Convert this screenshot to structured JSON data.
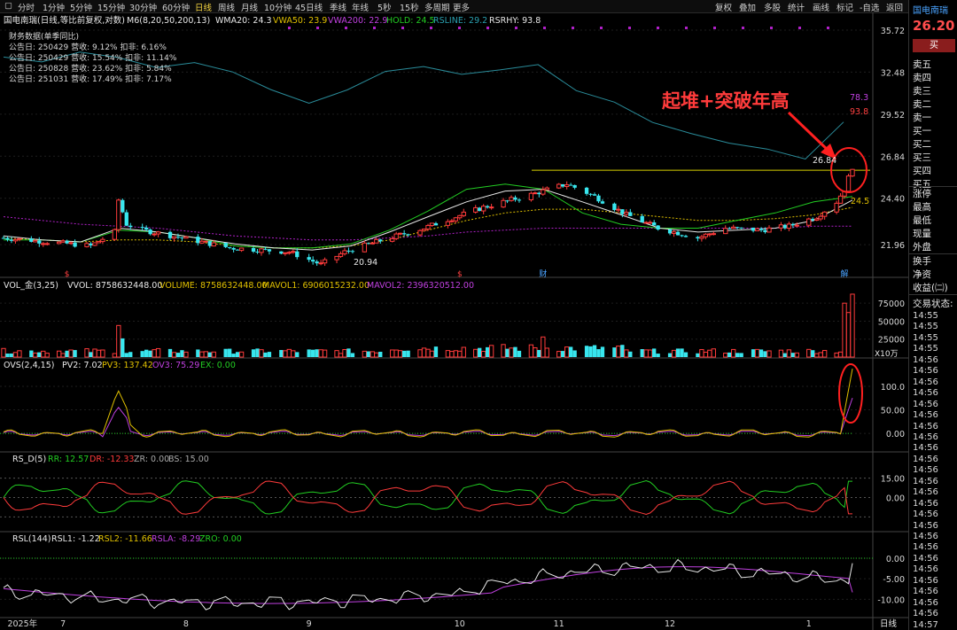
{
  "toolbar": {
    "left": [
      "分时",
      "1分钟",
      "5分钟",
      "15分钟",
      "30分钟",
      "60分钟",
      "日线",
      "周线",
      "月线",
      "10分钟",
      "45日线",
      "季线",
      "年线",
      "5秒",
      "15秒",
      "多周期",
      "更多"
    ],
    "active": "日线",
    "right": [
      "复权",
      "叠加",
      "多股",
      "统计",
      "画线",
      "标记",
      "-自选",
      "返回"
    ]
  },
  "main_pane": {
    "title": "国电南瑞(日线,等比前复权,对数)",
    "indicator": "M6(8,20,50,200,13)",
    "wma20": "WMA20: 24.3",
    "vwa50": "VWA50: 23.9",
    "vwa200": "VWA200: 22.9",
    "hold": "HOLD: 24.5",
    "rsline": "RSLINE: 29.2",
    "rsrhy": "RSRHY: 93.8",
    "fin_title": "财务数据(单季同比)",
    "fin_rows": [
      "公告日: 250429  营收: 9.12%  扣非: 6.16%",
      "公告日: 250429  营收: 15.54%  扣非: 11.14%",
      "公告日: 250828  营收: 23.62%  扣非: 5.84%",
      "公告日: 251031  营收: 17.49%  扣非: 7.17%"
    ],
    "annotation": "起堆+突破年高",
    "label_high": "26.84",
    "label_low": "20.94",
    "label_hold": "24.5",
    "label_rsline": "78.3",
    "label_rsrhy": "93.8",
    "markers": [
      {
        "text": "$",
        "x": "2025-07-02"
      },
      {
        "text": "$",
        "x": "2025-10-09"
      },
      {
        "text": "财",
        "x": "2025-10-30"
      },
      {
        "text": "解",
        "x": "2026-01-14"
      }
    ],
    "yticks": [
      "35.72",
      "32.48",
      "29.52",
      "26.84",
      "24.40",
      "21.96"
    ]
  },
  "vol_pane": {
    "title": "VOL_金(3,25)",
    "vvol": "VVOL: 8758632448.00",
    "volume": "VOLUME: 8758632448.00",
    "mavol1": "MAVOL1: 6906015232.00",
    "mavol2": "MAVOL2: 2396320512.00",
    "yticks": [
      "75000",
      "50000",
      "25000"
    ],
    "unit": "X10万"
  },
  "ovs_pane": {
    "title": "OVS(2,4,15)",
    "pv2": "PV2: 7.02",
    "pv3": "PV3: 137.42",
    "ov3": "OV3: 75.29",
    "ex": "EX: 0.00",
    "yticks": [
      "100.0",
      "50.00",
      "0.00"
    ]
  },
  "rsd_pane": {
    "title": "RS_D(5)",
    "rr": "RR: 12.57",
    "dr": "DR: -12.33",
    "zr": "ZR: 0.00",
    "bs": "BS: 15.00",
    "yticks": [
      "15.00",
      "0.00"
    ]
  },
  "rsl_pane": {
    "title": "RSL(144)",
    "rsl1": "RSL1: -1.22",
    "rsl2": "RSL2: -11.66",
    "rsla": "RSLA: -8.29",
    "zro": "ZRO: 0.00",
    "yticks": [
      "0.00",
      "-5.00",
      "-10.00"
    ]
  },
  "xaxis": {
    "labels": [
      "2025年",
      "7",
      "8",
      "9",
      "10",
      "11",
      "12",
      "1"
    ],
    "period": "日线"
  },
  "side": {
    "name": "国电南瑞",
    "price": "26.20",
    "price_suffix": "1.",
    "buy_button": "买",
    "order_book": [
      "卖五",
      "卖四",
      "卖三",
      "卖二",
      "卖一",
      "买一",
      "买二",
      "买三",
      "买四",
      "买五"
    ],
    "stats": [
      "涨停",
      "最高",
      "最低",
      "现量",
      "外盘"
    ],
    "stats2": [
      "换手",
      "净资",
      "收益(㈡)"
    ],
    "trade_status": "交易状态:",
    "times": [
      "14:55",
      "14:55",
      "14:55",
      "14:55",
      "14:56",
      "14:56",
      "14:56",
      "14:56",
      "14:56",
      "14:56",
      "14:56",
      "14:56",
      "14:56",
      "14:56",
      "14:56",
      "14:56",
      "14:56",
      "14:56",
      "14:56",
      "14:56",
      "14:56",
      "14:56",
      "14:56",
      "14:56",
      "14:56",
      "14:56",
      "14:56",
      "14:56",
      "14:57"
    ]
  },
  "colors": {
    "up": "#ff3b3b",
    "down": "#38e6ee",
    "wma20": "#e8e8e8",
    "vwa50": "#e0c000",
    "vwa200": "#b020c8",
    "hold": "#22cc22",
    "rsline": "#2a8c9a",
    "annotation": "#ff3b3b"
  },
  "chart_data": {
    "type": "candlestick",
    "title": "国电南瑞(日线,等比前复权,对数)",
    "x_range": [
      "2025-06-16",
      "2026-01-16"
    ],
    "y_scale": "log",
    "ylim": [
      20.6,
      35.72
    ],
    "trend_anchors": [
      {
        "x": "2025-06-16",
        "y": 22.3
      },
      {
        "x": "2025-06-27",
        "y": 22.1
      },
      {
        "x": "2025-07-08",
        "y": 21.9
      },
      {
        "x": "2025-07-14",
        "y": 22.6
      },
      {
        "x": "2025-07-15",
        "y": 24.3
      },
      {
        "x": "2025-07-17",
        "y": 23.0
      },
      {
        "x": "2025-07-21",
        "y": 22.7
      },
      {
        "x": "2025-07-31",
        "y": 22.3
      },
      {
        "x": "2025-08-12",
        "y": 21.8
      },
      {
        "x": "2025-08-27",
        "y": 21.6
      },
      {
        "x": "2025-09-04",
        "y": 21.0
      },
      {
        "x": "2025-09-10",
        "y": 21.6
      },
      {
        "x": "2025-09-18",
        "y": 22.1
      },
      {
        "x": "2025-09-30",
        "y": 22.8
      },
      {
        "x": "2025-10-15",
        "y": 23.9
      },
      {
        "x": "2025-10-27",
        "y": 24.6
      },
      {
        "x": "2025-11-05",
        "y": 25.2
      },
      {
        "x": "2025-11-12",
        "y": 24.5
      },
      {
        "x": "2025-11-20",
        "y": 23.5
      },
      {
        "x": "2025-11-28",
        "y": 22.8
      },
      {
        "x": "2025-12-08",
        "y": 22.3
      },
      {
        "x": "2025-12-15",
        "y": 22.8
      },
      {
        "x": "2025-12-24",
        "y": 22.7
      },
      {
        "x": "2025-12-31",
        "y": 22.9
      },
      {
        "x": "2026-01-07",
        "y": 23.4
      },
      {
        "x": "2026-01-12",
        "y": 24.2
      },
      {
        "x": "2026-01-14",
        "y": 24.9
      },
      {
        "x": "2026-01-16",
        "y": 26.2
      }
    ],
    "lines": {
      "WMA20": [
        22.4,
        22.2,
        22.1,
        22.8,
        22.6,
        22.3,
        22.0,
        21.8,
        21.7,
        21.9,
        22.6,
        23.4,
        24.2,
        24.8,
        24.9,
        24.2,
        23.5,
        22.8,
        22.6,
        22.7,
        22.8,
        23.2,
        24.3
      ],
      "VWA50": [
        22.3,
        22.2,
        22.1,
        22.2,
        22.2,
        22.1,
        21.9,
        21.8,
        21.8,
        21.9,
        22.2,
        22.7,
        23.2,
        23.6,
        23.8,
        23.8,
        23.6,
        23.4,
        23.2,
        23.2,
        23.3,
        23.5,
        23.9
      ],
      "VWA200": [
        23.4,
        23.2,
        23.0,
        22.9,
        22.8,
        22.6,
        22.4,
        22.3,
        22.2,
        22.2,
        22.3,
        22.4,
        22.6,
        22.7,
        22.8,
        22.8,
        22.8,
        22.8,
        22.8,
        22.8,
        22.8,
        22.9,
        22.9
      ],
      "HOLD": [
        22.2,
        22.2,
        22.1,
        22.7,
        22.6,
        22.3,
        21.9,
        21.8,
        21.8,
        22.0,
        22.7,
        23.7,
        24.9,
        25.2,
        24.9,
        23.6,
        23.0,
        22.8,
        22.8,
        23.2,
        23.6,
        24.2,
        24.5
      ],
      "RSLINE": [
        33.5,
        33.2,
        33.8,
        33.5,
        32.8,
        33.2,
        32.5,
        31.5,
        30.5,
        31.5,
        32.5,
        33.0,
        32.3,
        32.8,
        32.9,
        31.5,
        30.5,
        29.5,
        28.5,
        28.2,
        27.5,
        27.2,
        29.2
      ]
    },
    "resistance_line": 26.0,
    "volume": {
      "unit": "X10万",
      "ylim": [
        0,
        90000
      ],
      "baseline": 8000,
      "spikes": [
        {
          "x": "2025-07-15",
          "value": 44000
        },
        {
          "x": "2025-07-16",
          "value": 26000
        },
        {
          "x": "2025-10-30",
          "value": 28000
        },
        {
          "x": "2026-01-14",
          "value": 75000
        },
        {
          "x": "2026-01-15",
          "value": 62000
        },
        {
          "x": "2026-01-16",
          "value": 87586
        }
      ]
    },
    "ovs": {
      "ylim": [
        -30,
        130
      ],
      "PV2_last": 7.02,
      "PV3_last": 137.42,
      "OV3_last": 75.29,
      "EX": 0.0,
      "peak": {
        "x": "2025-07-15",
        "PV3": 90,
        "OV3": 55
      }
    },
    "rs_d": {
      "ylim": [
        -25,
        25
      ],
      "RR_last": 12.57,
      "DR_last": -12.33,
      "ZR": 0.0,
      "BS": 15.0
    },
    "rsl": {
      "ylim": [
        -14,
        3
      ],
      "RSL1_last": -1.22,
      "RSL2_last": -11.66,
      "RSLA_last": -8.29,
      "ZRO": 0.0
    }
  }
}
